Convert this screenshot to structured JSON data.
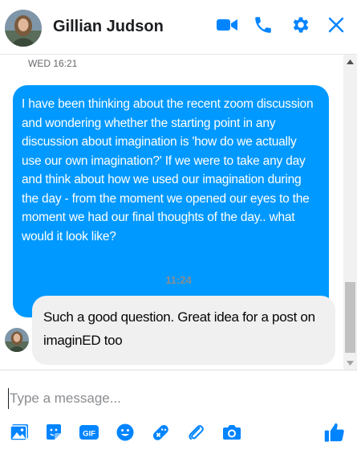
{
  "header": {
    "contact_name": "Gillian Judson",
    "actions": [
      {
        "icon": "video-camera-icon",
        "label": "Video call"
      },
      {
        "icon": "phone-icon",
        "label": "Voice call"
      },
      {
        "icon": "gear-icon",
        "label": "Settings"
      },
      {
        "icon": "close-icon",
        "label": "Close"
      }
    ]
  },
  "conversation": {
    "date_divider": "WED 16:21",
    "messages": [
      {
        "direction": "outgoing",
        "text": "I have been thinking about the recent zoom discussion and wondering whether the starting point in any discussion about imagination is 'how do we actually use our own imagination?'  If we were to take any day and think about how we used our imagination during the day - from the moment we opened our eyes to the moment we had our final thoughts of the day.. what would it look like?"
      },
      {
        "direction": "incoming",
        "time_divider": "11:24",
        "text": "Such a good question. Great idea for a post on imaginED too"
      }
    ]
  },
  "composer": {
    "placeholder": "Type a message...",
    "value": "",
    "tools": [
      "image-icon",
      "sticker-icon",
      "gif-icon",
      "emoji-icon",
      "game-icon",
      "attachment-icon",
      "camera-icon"
    ],
    "like_icon": "thumbs-up-icon"
  },
  "colors": {
    "accent": "#0084ff",
    "outgoing_bubble": "#0099ff",
    "incoming_bubble": "#f0f0f0"
  }
}
